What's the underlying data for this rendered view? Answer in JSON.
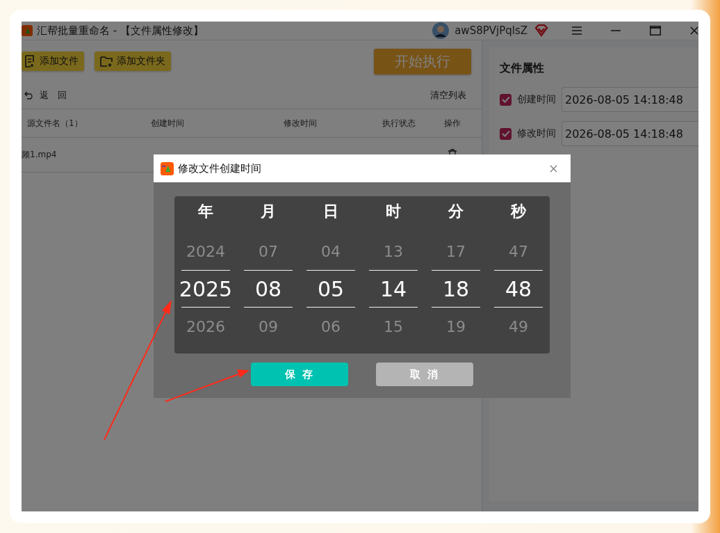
{
  "window": {
    "title": "汇帮批量重命名 - 【文件属性修改】",
    "user": "awS8PVjPqlsZ"
  },
  "toolbar": {
    "buttons": [
      {
        "label": "添加文件",
        "kind": "file"
      },
      {
        "label": "添加文件夹",
        "kind": "folder"
      }
    ],
    "start": "开始执行"
  },
  "list_bar": {
    "back": "返　回",
    "clear": "清空列表"
  },
  "table": {
    "columns": [
      "源文件名（1）",
      "创建时间",
      "修改时间",
      "执行状态",
      "操作"
    ],
    "rows": [
      {
        "cells": [
          "频1.mp4"
        ]
      }
    ]
  },
  "properties": {
    "title": "文件属性",
    "fields": [
      {
        "label": "创建时间",
        "checked": true,
        "value": "2026-08-05 14:18:48"
      },
      {
        "label": "修改时间",
        "checked": true,
        "value": "2026-08-05 14:18:48"
      }
    ]
  },
  "dialog": {
    "title": "修改文件创建时间",
    "columns": [
      {
        "heading": "年",
        "above": "2024",
        "value": "2025",
        "below": "2026"
      },
      {
        "heading": "月",
        "above": "07",
        "value": "08",
        "below": "09"
      },
      {
        "heading": "日",
        "above": "04",
        "value": "05",
        "below": "06"
      },
      {
        "heading": "时",
        "above": "13",
        "value": "14",
        "below": "15"
      },
      {
        "heading": "分",
        "above": "17",
        "value": "18",
        "below": "19"
      },
      {
        "heading": "秒",
        "above": "47",
        "value": "48",
        "below": "49"
      }
    ],
    "buttons": [
      {
        "label": "保 存",
        "kind": "primary"
      },
      {
        "label": "取 消",
        "kind": "secondary"
      }
    ]
  }
}
